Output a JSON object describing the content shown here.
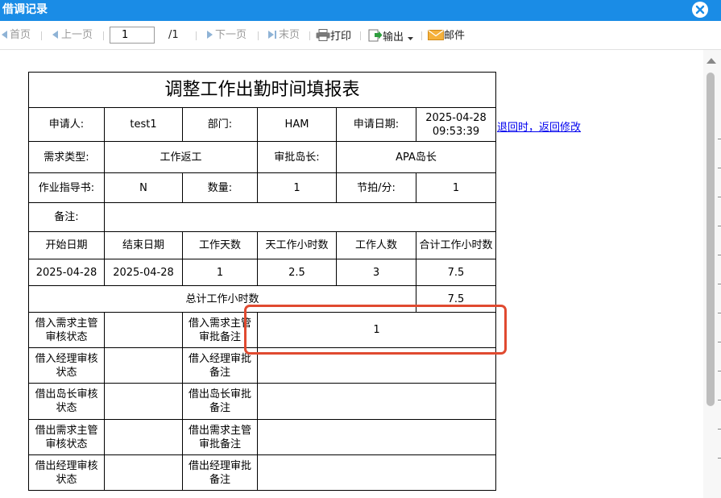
{
  "window": {
    "title": "借调记录"
  },
  "toolbar": {
    "first": "首页",
    "prev": "上一页",
    "page_value": "1",
    "page_total": "/1",
    "next": "下一页",
    "last": "末页",
    "print": "打印",
    "export": "输出",
    "mail": "邮件"
  },
  "form": {
    "title": "调整工作出勤时间填报表",
    "applicant_label": "申请人:",
    "applicant_value": "test1",
    "dept_label": "部门:",
    "dept_value": "HAM",
    "apply_date_label": "申请日期:",
    "apply_date_value": "2025-04-28",
    "apply_time_value": "09:53:39",
    "demand_type_label": "需求类型:",
    "demand_type_value": "工作返工",
    "approver_label": "审批岛长:",
    "approver_value": "APA岛长",
    "guide_label": "作业指导书:",
    "guide_value": "N",
    "qty_label": "数量:",
    "qty_value": "1",
    "takt_label": "节拍/分:",
    "takt_value": "1",
    "remark_label": "备注:",
    "remark_value": "",
    "columns": [
      "开始日期",
      "结束日期",
      "工作天数",
      "天工作小时数",
      "工作人数",
      "合计工作小时数"
    ],
    "row": [
      "2025-04-28",
      "2025-04-28",
      "1",
      "2.5",
      "3",
      "7.5"
    ],
    "total_label": "总计工作小时数",
    "total_value": "7.5",
    "approvals": [
      {
        "status_label": "借入需求主管审核状态",
        "status_value": "",
        "note_label": "借入需求主管审批备注",
        "note_value": "1"
      },
      {
        "status_label": "借入经理审核状态",
        "status_value": "",
        "note_label": "借入经理审批备注",
        "note_value": ""
      },
      {
        "status_label": "借出岛长审核状态",
        "status_value": "",
        "note_label": "借出岛长审批备注",
        "note_value": ""
      },
      {
        "status_label": "借出需求主管审核状态",
        "status_value": "",
        "note_label": "借出需求主管审批备注",
        "note_value": ""
      },
      {
        "status_label": "借出经理审核状态",
        "status_value": "",
        "note_label": "借出经理审批备注",
        "note_value": ""
      }
    ]
  },
  "side_link": "退回时，返回修改",
  "colors": {
    "titlebar": "#1a8ce6",
    "highlight": "#e04a30",
    "link": "#0000ee"
  }
}
